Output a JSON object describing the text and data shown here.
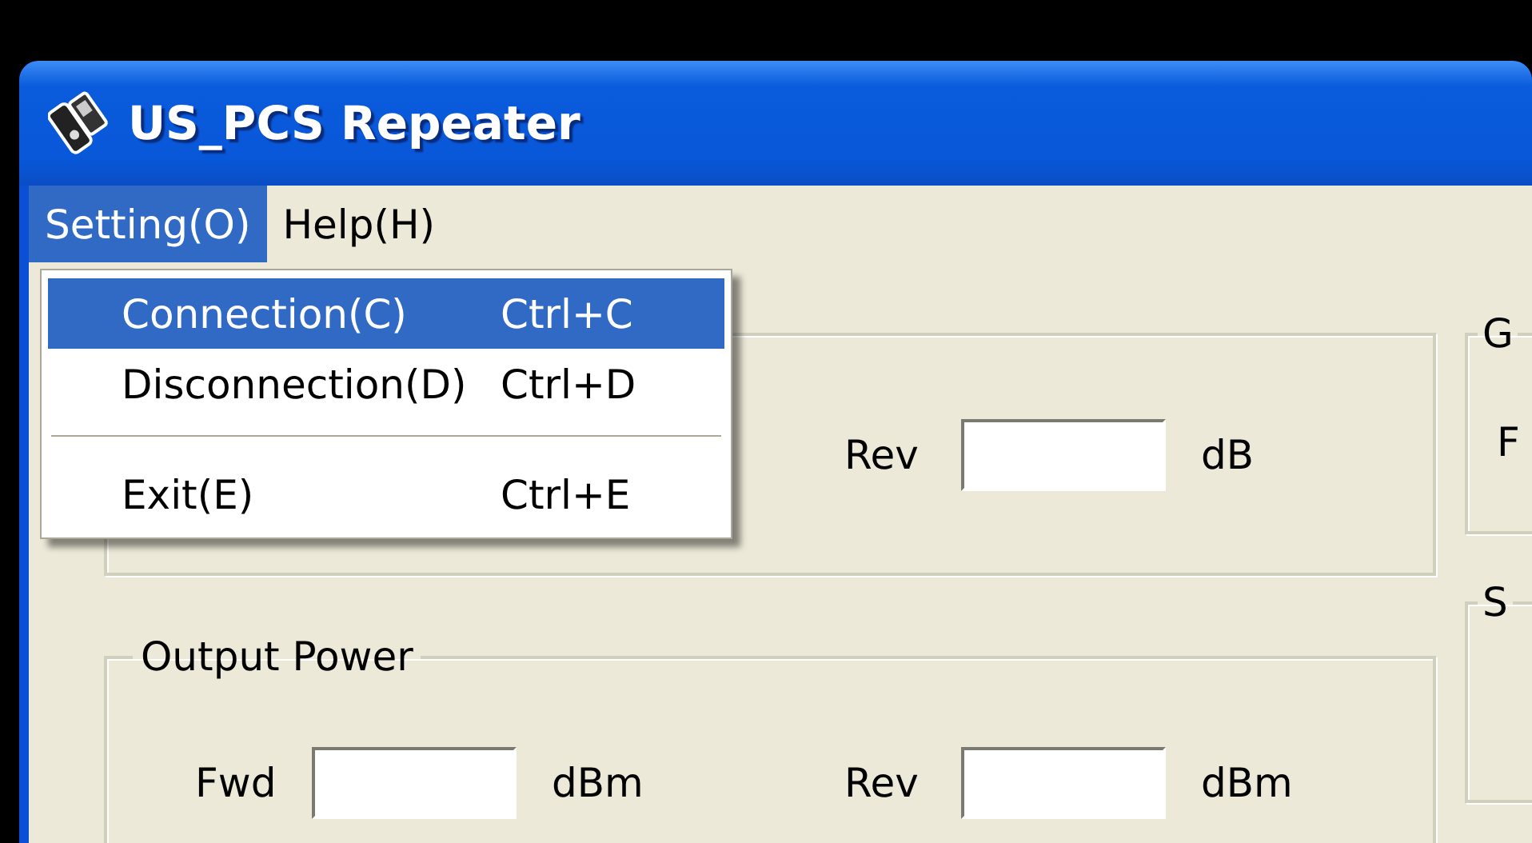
{
  "window": {
    "title": "US_PCS Repeater"
  },
  "menu_bar": [
    {
      "label": "Setting(O)",
      "selected": true
    },
    {
      "label": "Help(H)",
      "selected": false
    }
  ],
  "dropdown_menu": [
    {
      "kind": "item",
      "label": "Connection(C)",
      "shortcut": "Ctrl+C",
      "selected": true
    },
    {
      "kind": "item",
      "label": "Disconnection(D)",
      "shortcut": "Ctrl+D",
      "selected": false
    },
    {
      "kind": "separator"
    },
    {
      "kind": "item",
      "label": "Exit(E)",
      "shortcut": "Ctrl+E",
      "selected": false
    }
  ],
  "groups": [
    {
      "fields": [
        {
          "label": "Rev",
          "unit": "dB"
        }
      ]
    },
    {
      "title": "Output Power",
      "fields": [
        {
          "label": "Fwd",
          "unit": "dBm"
        },
        {
          "label": "Rev",
          "unit": "dBm"
        }
      ]
    }
  ],
  "side_groups": [
    {
      "title": "G",
      "fields": [
        {
          "label": "F"
        }
      ]
    },
    {
      "title": "S"
    }
  ]
}
